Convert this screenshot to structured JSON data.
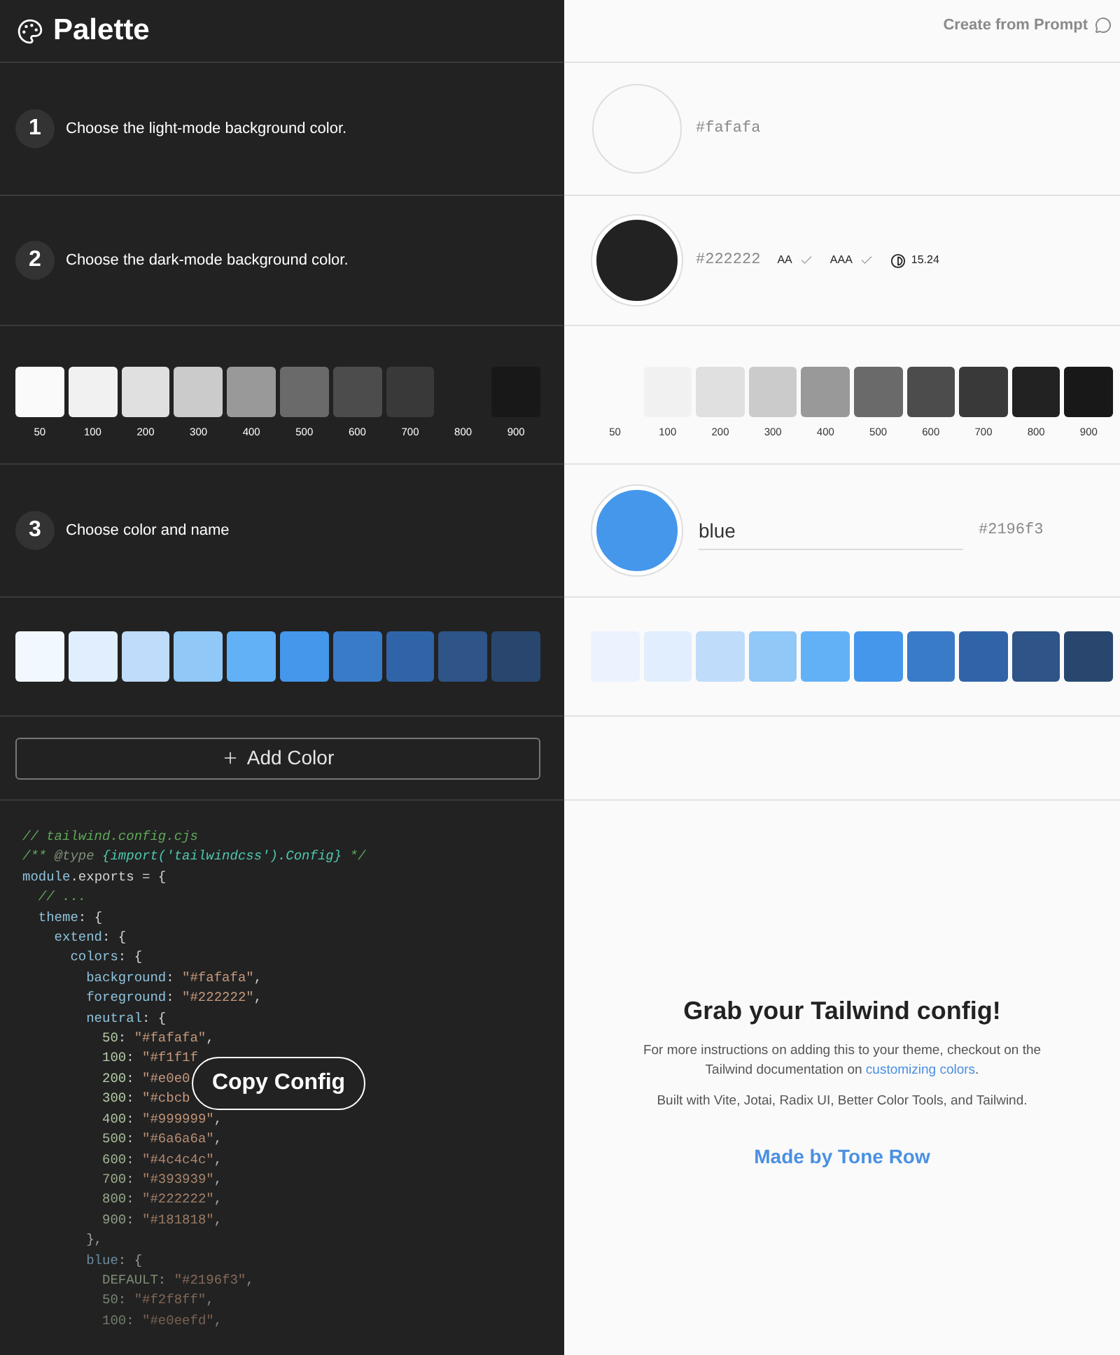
{
  "header": {
    "title": "Palette",
    "prompt_link": "Create from Prompt"
  },
  "light_background": {
    "number": "1",
    "label": "Choose the light-mode background color.",
    "hex": "#fafafa",
    "color": "#fafafa"
  },
  "dark_background": {
    "number": "2",
    "label": "Choose the dark-mode background color.",
    "hex": "#222222",
    "color": "#222222",
    "checks": [
      {
        "label": "AA",
        "passed": true
      },
      {
        "label": "AAA",
        "passed": true
      }
    ],
    "contrast": "15.24"
  },
  "neutral_scale": {
    "dark_side": [
      {
        "label": "50",
        "color": "#fafafa"
      },
      {
        "label": "100",
        "color": "#f1f1f1"
      },
      {
        "label": "200",
        "color": "#e0e0e0"
      },
      {
        "label": "300",
        "color": "#cbcbcb"
      },
      {
        "label": "400",
        "color": "#999999"
      },
      {
        "label": "500",
        "color": "#6a6a6a"
      },
      {
        "label": "600",
        "color": "#4c4c4c"
      },
      {
        "label": "700",
        "color": "#393939"
      },
      {
        "label": "800"
      },
      {
        "label": "900",
        "color": "#181818"
      }
    ],
    "light_side": [
      {
        "label": "50"
      },
      {
        "label": "100",
        "color": "#f1f1f1"
      },
      {
        "label": "200",
        "color": "#e0e0e0"
      },
      {
        "label": "300",
        "color": "#cbcbcb"
      },
      {
        "label": "400",
        "color": "#999999"
      },
      {
        "label": "500",
        "color": "#6a6a6a"
      },
      {
        "label": "600",
        "color": "#4c4c4c"
      },
      {
        "label": "700",
        "color": "#393939"
      },
      {
        "label": "800",
        "color": "#222222"
      },
      {
        "label": "900",
        "color": "#181818"
      }
    ]
  },
  "color_step": {
    "number": "3",
    "label": "Choose color and name",
    "name": "blue",
    "hex": "#2196f3",
    "color": "#4497eb"
  },
  "blue_scale": {
    "dark_side": [
      {
        "color": "#f2f8ff"
      },
      {
        "color": "#e0eefd"
      },
      {
        "color": "#bfdcfa"
      },
      {
        "color": "#90c8f8"
      },
      {
        "color": "#62b1f6"
      },
      {
        "color": "#4497eb"
      },
      {
        "color": "#3a7bc8"
      },
      {
        "color": "#2f64a8"
      },
      {
        "color": "#2e5488"
      },
      {
        "color": "#29476e"
      }
    ],
    "light_side": [
      {
        "color": "#ebf3fe"
      },
      {
        "color": "#e0eefd"
      },
      {
        "color": "#bfdcfa"
      },
      {
        "color": "#90c8f8"
      },
      {
        "color": "#62b1f6"
      },
      {
        "color": "#4497eb"
      },
      {
        "color": "#3a7bc8"
      },
      {
        "color": "#2f64a8"
      },
      {
        "color": "#2e5488"
      },
      {
        "color": "#29476e"
      }
    ]
  },
  "add_color_button": "Add Color",
  "config": {
    "lines": [
      [
        {
          "kind": "comment",
          "t": "// tailwind.config.cjs"
        }
      ],
      [
        {
          "kind": "comment",
          "t": "/** "
        },
        {
          "kind": "tag",
          "t": "@type"
        },
        {
          "kind": "type",
          "t": " {import('tailwindcss').Config}"
        },
        {
          "kind": "comment",
          "t": " */"
        }
      ],
      [
        {
          "kind": "key",
          "t": "module"
        },
        {
          "kind": "plain",
          "t": ".exports = {"
        }
      ],
      [
        {
          "kind": "comment",
          "t": "  // ..."
        }
      ],
      [
        {
          "kind": "key",
          "t": "  theme"
        },
        {
          "kind": "plain",
          "t": ": {"
        }
      ],
      [
        {
          "kind": "key",
          "t": "    extend"
        },
        {
          "kind": "plain",
          "t": ": {"
        }
      ],
      [
        {
          "kind": "key",
          "t": "      colors"
        },
        {
          "kind": "plain",
          "t": ": {"
        }
      ],
      [
        {
          "kind": "key",
          "t": "        background"
        },
        {
          "kind": "plain",
          "t": ": "
        },
        {
          "kind": "string",
          "t": "\"#fafafa\""
        },
        {
          "kind": "plain",
          "t": ","
        }
      ],
      [
        {
          "kind": "key",
          "t": "        foreground"
        },
        {
          "kind": "plain",
          "t": ": "
        },
        {
          "kind": "string",
          "t": "\"#222222\""
        },
        {
          "kind": "plain",
          "t": ","
        }
      ],
      [
        {
          "kind": "key",
          "t": "        neutral"
        },
        {
          "kind": "plain",
          "t": ": {"
        }
      ],
      [
        {
          "kind": "num",
          "t": "          50"
        },
        {
          "kind": "plain",
          "t": ": "
        },
        {
          "kind": "string",
          "t": "\"#fafafa\""
        },
        {
          "kind": "plain",
          "t": ","
        }
      ],
      [
        {
          "kind": "num",
          "t": "          100"
        },
        {
          "kind": "plain",
          "t": ": "
        },
        {
          "kind": "string",
          "t": "\"#f1f1f"
        }
      ],
      [
        {
          "kind": "num",
          "t": "          200"
        },
        {
          "kind": "plain",
          "t": ": "
        },
        {
          "kind": "string",
          "t": "\"#e0e0"
        }
      ],
      [
        {
          "kind": "num",
          "t": "          300"
        },
        {
          "kind": "plain",
          "t": ": "
        },
        {
          "kind": "string",
          "t": "\"#cbcb"
        }
      ],
      [
        {
          "kind": "num",
          "t": "          400"
        },
        {
          "kind": "plain",
          "t": ": "
        },
        {
          "kind": "string",
          "t": "\"#999999\""
        },
        {
          "kind": "plain",
          "t": ","
        }
      ],
      [
        {
          "kind": "num",
          "t": "          500"
        },
        {
          "kind": "plain",
          "t": ": "
        },
        {
          "kind": "string",
          "t": "\"#6a6a6a\""
        },
        {
          "kind": "plain",
          "t": ","
        }
      ],
      [
        {
          "kind": "num",
          "t": "          600"
        },
        {
          "kind": "plain",
          "t": ": "
        },
        {
          "kind": "string",
          "t": "\"#4c4c4c\""
        },
        {
          "kind": "plain",
          "t": ","
        }
      ],
      [
        {
          "kind": "num",
          "t": "          700"
        },
        {
          "kind": "plain",
          "t": ": "
        },
        {
          "kind": "string",
          "t": "\"#393939\""
        },
        {
          "kind": "plain",
          "t": ","
        }
      ],
      [
        {
          "kind": "num",
          "t": "          800"
        },
        {
          "kind": "plain",
          "t": ": "
        },
        {
          "kind": "string",
          "t": "\"#222222\""
        },
        {
          "kind": "plain",
          "t": ","
        }
      ],
      [
        {
          "kind": "num",
          "t": "          900"
        },
        {
          "kind": "plain",
          "t": ": "
        },
        {
          "kind": "string",
          "t": "\"#181818\""
        },
        {
          "kind": "plain",
          "t": ","
        }
      ],
      [
        {
          "kind": "plain",
          "t": "        },"
        }
      ],
      [
        {
          "kind": "key",
          "t": "        blue"
        },
        {
          "kind": "plain",
          "t": ": {"
        }
      ],
      [
        {
          "kind": "num",
          "t": "          DEFAULT"
        },
        {
          "kind": "plain",
          "t": ": "
        },
        {
          "kind": "string",
          "t": "\"#2196f3\""
        },
        {
          "kind": "plain",
          "t": ","
        }
      ],
      [
        {
          "kind": "num",
          "t": "          50"
        },
        {
          "kind": "plain",
          "t": ": "
        },
        {
          "kind": "string",
          "t": "\"#f2f8ff\""
        },
        {
          "kind": "plain",
          "t": ","
        }
      ],
      [
        {
          "kind": "num",
          "t": "          100"
        },
        {
          "kind": "plain",
          "t": ": "
        },
        {
          "kind": "string",
          "t": "\"#e0eefd\""
        },
        {
          "kind": "plain",
          "t": ","
        }
      ]
    ]
  },
  "copy_button": "Copy Config",
  "footer": {
    "title": "Grab your Tailwind config!",
    "text_before": "For more instructions on adding this to your theme, checkout on the Tailwind documentation on",
    "link": "customizing colors",
    "text_after": ".",
    "credits": "Built with Vite, Jotai, Radix UI, Better Color Tools, and Tailwind.",
    "made_by": "Made by Tone Row"
  }
}
